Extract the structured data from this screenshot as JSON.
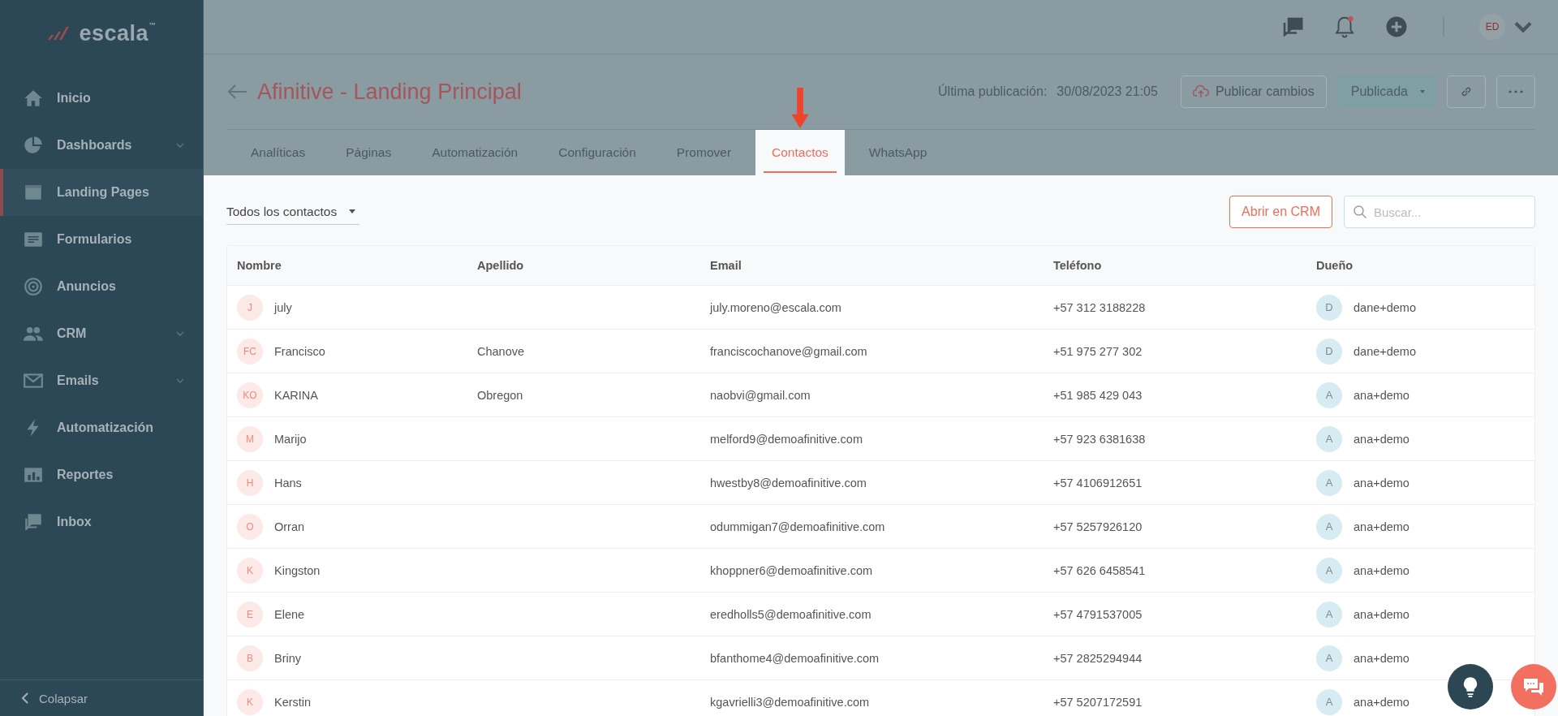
{
  "logo": {
    "name": "escala",
    "mark": "™"
  },
  "sidebar": {
    "items": [
      {
        "label": "Inicio",
        "expandable": false,
        "selected": false
      },
      {
        "label": "Dashboards",
        "expandable": true,
        "selected": false
      },
      {
        "label": "Landing Pages",
        "expandable": false,
        "selected": true
      },
      {
        "label": "Formularios",
        "expandable": false,
        "selected": false
      },
      {
        "label": "Anuncios",
        "expandable": false,
        "selected": false
      },
      {
        "label": "CRM",
        "expandable": true,
        "selected": false
      },
      {
        "label": "Emails",
        "expandable": true,
        "selected": false
      },
      {
        "label": "Automatización",
        "expandable": false,
        "selected": false
      },
      {
        "label": "Reportes",
        "expandable": false,
        "selected": false
      },
      {
        "label": "Inbox",
        "expandable": false,
        "selected": false
      }
    ],
    "collapse": "Colapsar"
  },
  "topbar": {
    "notifications_unread": true,
    "avatar": "ED"
  },
  "page": {
    "title": "Afinitive - Landing Principal",
    "last_published_label": "Última publicación:",
    "last_published": "30/08/2023 21:05",
    "publish_button": "Publicar cambios",
    "status_button": "Publicada"
  },
  "tabs": [
    {
      "label": "Analíticas",
      "selected": false
    },
    {
      "label": "Páginas",
      "selected": false
    },
    {
      "label": "Automatización",
      "selected": false
    },
    {
      "label": "Configuración",
      "selected": false
    },
    {
      "label": "Promover",
      "selected": false
    },
    {
      "label": "Contactos",
      "selected": true
    },
    {
      "label": "WhatsApp",
      "selected": false
    }
  ],
  "toolbar": {
    "filter": "Todos los contactos",
    "crm_button": "Abrir en CRM",
    "search": {
      "placeholder": "Buscar..."
    }
  },
  "table": {
    "columns": [
      "Nombre",
      "Apellido",
      "Email",
      "Teléfono",
      "Dueño"
    ],
    "rows": [
      {
        "initials": "J",
        "nombre": "july",
        "apellido": "",
        "email": "july.moreno@escala.com",
        "telefono": "+57 312 3188228",
        "owner_initial": "D",
        "owner": "dane+demo"
      },
      {
        "initials": "FC",
        "nombre": "Francisco",
        "apellido": "Chanove",
        "email": "franciscochanove@gmail.com",
        "telefono": "+51 975 277 302",
        "owner_initial": "D",
        "owner": "dane+demo"
      },
      {
        "initials": "KO",
        "nombre": "KARINA",
        "apellido": "Obregon",
        "email": "naobvi@gmail.com",
        "telefono": "+51 985 429 043",
        "owner_initial": "A",
        "owner": "ana+demo"
      },
      {
        "initials": "M",
        "nombre": "Marijo",
        "apellido": "",
        "email": "melford9@demoafinitive.com",
        "telefono": "+57 923 6381638",
        "owner_initial": "A",
        "owner": "ana+demo"
      },
      {
        "initials": "H",
        "nombre": "Hans",
        "apellido": "",
        "email": "hwestby8@demoafinitive.com",
        "telefono": "+57 4106912651",
        "owner_initial": "A",
        "owner": "ana+demo"
      },
      {
        "initials": "O",
        "nombre": "Orran",
        "apellido": "",
        "email": "odummigan7@demoafinitive.com",
        "telefono": "+57 5257926120",
        "owner_initial": "A",
        "owner": "ana+demo"
      },
      {
        "initials": "K",
        "nombre": "Kingston",
        "apellido": "",
        "email": "khoppner6@demoafinitive.com",
        "telefono": "+57 626 6458541",
        "owner_initial": "A",
        "owner": "ana+demo"
      },
      {
        "initials": "E",
        "nombre": "Elene",
        "apellido": "",
        "email": "eredholls5@demoafinitive.com",
        "telefono": "+57 4791537005",
        "owner_initial": "A",
        "owner": "ana+demo"
      },
      {
        "initials": "B",
        "nombre": "Briny",
        "apellido": "",
        "email": "bfanthome4@demoafinitive.com",
        "telefono": "+57 2825294944",
        "owner_initial": "A",
        "owner": "ana+demo"
      },
      {
        "initials": "K",
        "nombre": "Kerstin",
        "apellido": "",
        "email": "kgavrielli3@demoafinitive.com",
        "telefono": "+57 5207172591",
        "owner_initial": "A",
        "owner": "ana+demo"
      }
    ]
  }
}
